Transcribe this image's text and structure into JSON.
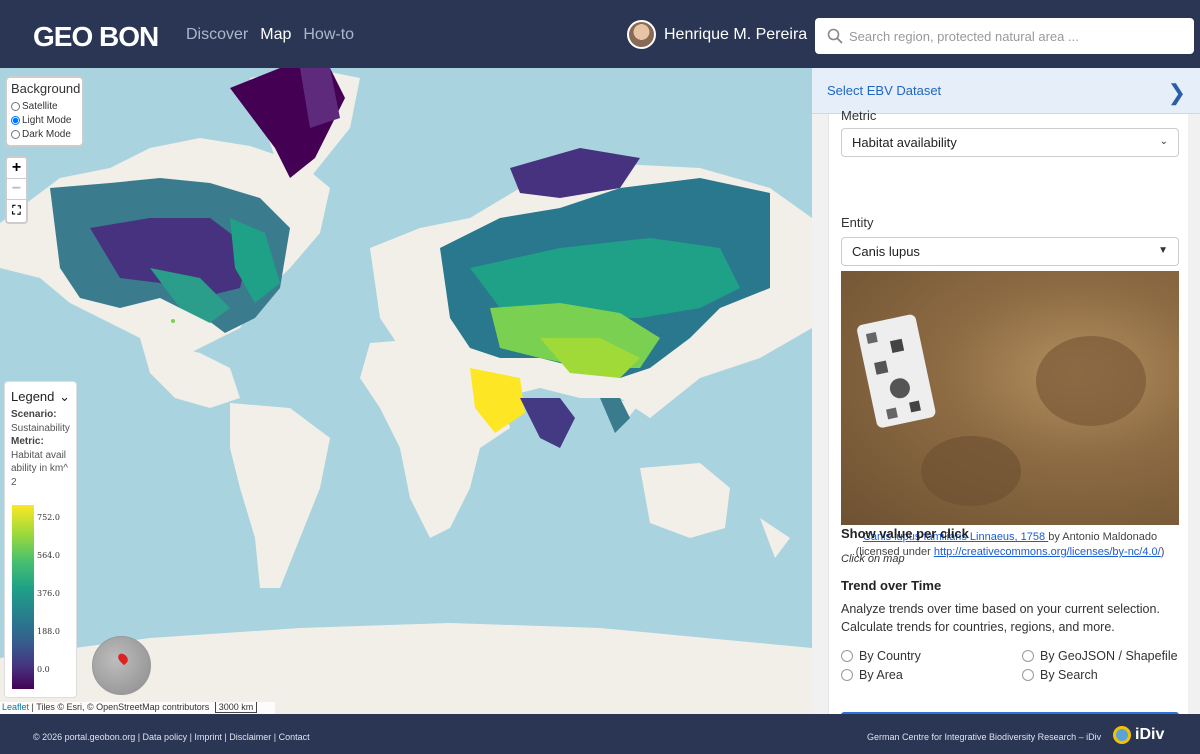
{
  "header": {
    "logo": "GEO BON",
    "nav": [
      "Discover",
      "Map",
      "How-to"
    ],
    "active_nav": "Map",
    "user_name": "Henrique M. Pereira",
    "search_placeholder": "Search region, protected natural area ..."
  },
  "map": {
    "background": {
      "title": "Background",
      "options": [
        "Satellite",
        "Light Mode",
        "Dark Mode"
      ],
      "selected": "Light Mode"
    },
    "zoom": {
      "in": "+",
      "out": "−",
      "fullscreen": "⛶"
    },
    "legend": {
      "title": "Legend",
      "scenario_label": "Scenario:",
      "scenario_value": "Sustainability",
      "metric_label": "Metric:",
      "metric_value": "Habitat availability in km^2",
      "ticks": [
        "752.0",
        "564.0",
        "376.0",
        "188.0",
        "0.0"
      ],
      "ramp_colors": [
        "#fde725",
        "#4ac16d",
        "#277f8e",
        "#46327e",
        "#440154"
      ]
    },
    "attribution": {
      "leaflet": "Leaflet",
      "tiles": "| Tiles © Esri, © OpenStreetMap contributors",
      "scale": "3000 km"
    }
  },
  "panel": {
    "header": "Select EBV Dataset",
    "metric_label": "Metric",
    "metric_value": "Habitat availability",
    "entity_label": "Entity",
    "entity_value": "Canis lupus",
    "caption_link": "Canis lupus familiaris Linnaeus, 1758 ",
    "caption_by": "by Antonio Maldonado (licensed under ",
    "caption_url": "http://creativecommons.org/licenses/by-nc/4.0/",
    "caption_end": ")",
    "show_value_title": "Show value per click",
    "click_on_map": "Click on map",
    "trend_title": "Trend over Time",
    "trend_desc": "Analyze trends over time based on your current selection. Calculate trends for countries, regions, and more.",
    "options": [
      "By Country",
      "By GeoJSON / Shapefile",
      "By Area",
      "By Search"
    ]
  },
  "footer": {
    "left": "© 2026 portal.geobon.org | Data policy | Imprint | Disclaimer | Contact",
    "right": "German Centre for Integrative Biodiversity Research – iDiv",
    "brand": "iDiv"
  }
}
